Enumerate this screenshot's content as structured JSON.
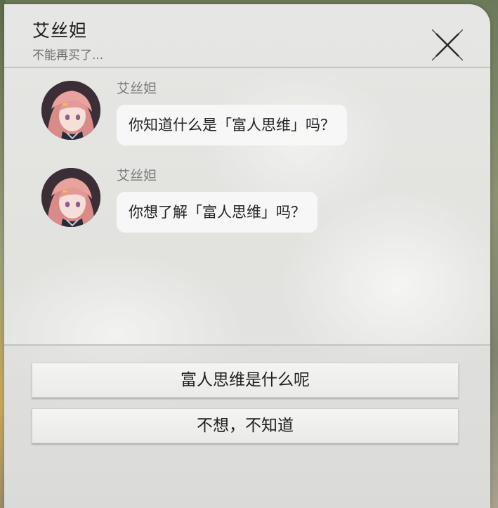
{
  "dialog": {
    "title": "艾丝妲",
    "subtitle": "不能再买了...",
    "close_icon": "close-x-icon"
  },
  "messages": [
    {
      "sender": "艾丝妲",
      "text": "你知道什么是「富人思维」吗？",
      "avatar": "character-portrait"
    },
    {
      "sender": "艾丝妲",
      "text": "你想了解「富人思维」吗？",
      "avatar": "character-portrait"
    }
  ],
  "options": [
    {
      "label": "富人思维是什么呢"
    },
    {
      "label": "不想，不知道"
    }
  ],
  "colors": {
    "panel": "#e4e4e2",
    "bubble": "#f8f8f8",
    "title_text": "#1c1c1c",
    "muted_text": "#7a7a7a"
  }
}
